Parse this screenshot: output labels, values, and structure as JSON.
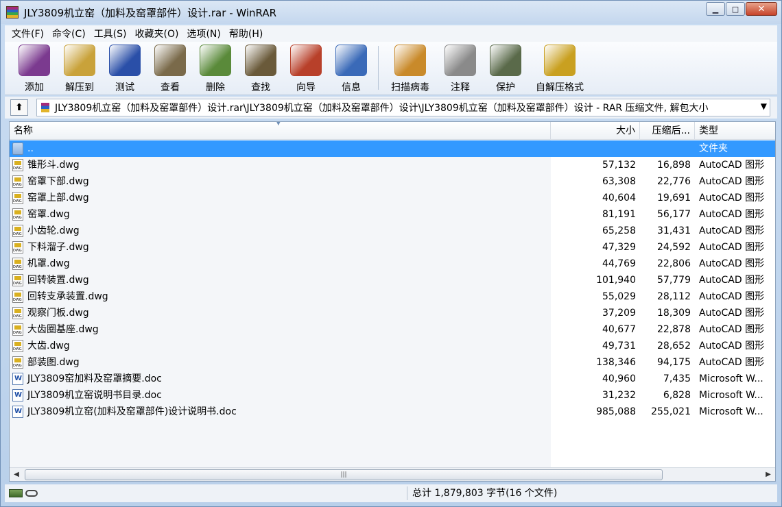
{
  "window": {
    "title": "JLY3809机立窑（加料及窑罩部件）设计.rar - WinRAR",
    "minimize": "▁",
    "maximize": "□",
    "close": "✕"
  },
  "menu": [
    "文件(F)",
    "命令(C)",
    "工具(S)",
    "收藏夹(O)",
    "选项(N)",
    "帮助(H)"
  ],
  "toolbar": [
    {
      "label": "添加",
      "icon": "add-icon",
      "color": "#7b3a8f"
    },
    {
      "label": "解压到",
      "icon": "extract-to-icon",
      "color": "#c9a23a"
    },
    {
      "label": "测试",
      "icon": "test-icon",
      "color": "#2a4fa8"
    },
    {
      "label": "查看",
      "icon": "view-icon",
      "color": "#7a6a4a"
    },
    {
      "label": "删除",
      "icon": "delete-icon",
      "color": "#5a8a3a"
    },
    {
      "label": "查找",
      "icon": "find-icon",
      "color": "#6a5a3a"
    },
    {
      "label": "向导",
      "icon": "wizard-icon",
      "color": "#b8402a"
    },
    {
      "label": "信息",
      "icon": "info-icon",
      "color": "#3a6ab8"
    },
    {
      "label": "扫描病毒",
      "icon": "virus-scan-icon",
      "color": "#c98a2a"
    },
    {
      "label": "注释",
      "icon": "comment-icon",
      "color": "#8a8a8a"
    },
    {
      "label": "保护",
      "icon": "protect-icon",
      "color": "#5a6a4a"
    },
    {
      "label": "自解压格式",
      "icon": "sfx-icon",
      "color": "#c9a020"
    }
  ],
  "address": {
    "up": "⬆",
    "path": "JLY3809机立窑（加料及窑罩部件）设计.rar\\JLY3809机立窑（加料及窑罩部件）设计\\JLY3809机立窑（加料及窑罩部件）设计 - RAR 压缩文件, 解包大小",
    "dropdown": "▼"
  },
  "columns": {
    "name": "名称",
    "size": "大小",
    "packed": "压缩后...",
    "type": "类型"
  },
  "files": [
    {
      "name": "..",
      "size": "",
      "packed": "",
      "type": "文件夹",
      "kind": "folder",
      "selected": true
    },
    {
      "name": "锥形斗.dwg",
      "size": "57,132",
      "packed": "16,898",
      "type": "AutoCAD 图形",
      "kind": "dwg"
    },
    {
      "name": "窑罩下部.dwg",
      "size": "63,308",
      "packed": "22,776",
      "type": "AutoCAD 图形",
      "kind": "dwg"
    },
    {
      "name": "窑罩上部.dwg",
      "size": "40,604",
      "packed": "19,691",
      "type": "AutoCAD 图形",
      "kind": "dwg"
    },
    {
      "name": "窑罩.dwg",
      "size": "81,191",
      "packed": "56,177",
      "type": "AutoCAD 图形",
      "kind": "dwg"
    },
    {
      "name": "小齿轮.dwg",
      "size": "65,258",
      "packed": "31,431",
      "type": "AutoCAD 图形",
      "kind": "dwg"
    },
    {
      "name": "下料溜子.dwg",
      "size": "47,329",
      "packed": "24,592",
      "type": "AutoCAD 图形",
      "kind": "dwg"
    },
    {
      "name": "机罩.dwg",
      "size": "44,769",
      "packed": "22,806",
      "type": "AutoCAD 图形",
      "kind": "dwg"
    },
    {
      "name": "回转装置.dwg",
      "size": "101,940",
      "packed": "57,779",
      "type": "AutoCAD 图形",
      "kind": "dwg"
    },
    {
      "name": "回转支承装置.dwg",
      "size": "55,029",
      "packed": "28,112",
      "type": "AutoCAD 图形",
      "kind": "dwg"
    },
    {
      "name": "观察门板.dwg",
      "size": "37,209",
      "packed": "18,309",
      "type": "AutoCAD 图形",
      "kind": "dwg"
    },
    {
      "name": "大齿圈基座.dwg",
      "size": "40,677",
      "packed": "22,878",
      "type": "AutoCAD 图形",
      "kind": "dwg"
    },
    {
      "name": "大齿.dwg",
      "size": "49,731",
      "packed": "28,652",
      "type": "AutoCAD 图形",
      "kind": "dwg"
    },
    {
      "name": "部装图.dwg",
      "size": "138,346",
      "packed": "94,175",
      "type": "AutoCAD 图形",
      "kind": "dwg"
    },
    {
      "name": "JLY3809窑加料及窑罩摘要.doc",
      "size": "40,960",
      "packed": "7,435",
      "type": "Microsoft W...",
      "kind": "doc"
    },
    {
      "name": "JLY3809机立窑说明书目录.doc",
      "size": "31,232",
      "packed": "6,828",
      "type": "Microsoft W...",
      "kind": "doc"
    },
    {
      "name": "JLY3809机立窑(加料及窑罩部件)设计说明书.doc",
      "size": "985,088",
      "packed": "255,021",
      "type": "Microsoft W...",
      "kind": "doc"
    }
  ],
  "scrollbar": {
    "left": "◀",
    "right": "▶",
    "grip": "|||"
  },
  "status": {
    "summary": "总计 1,879,803 字节(16 个文件)"
  }
}
